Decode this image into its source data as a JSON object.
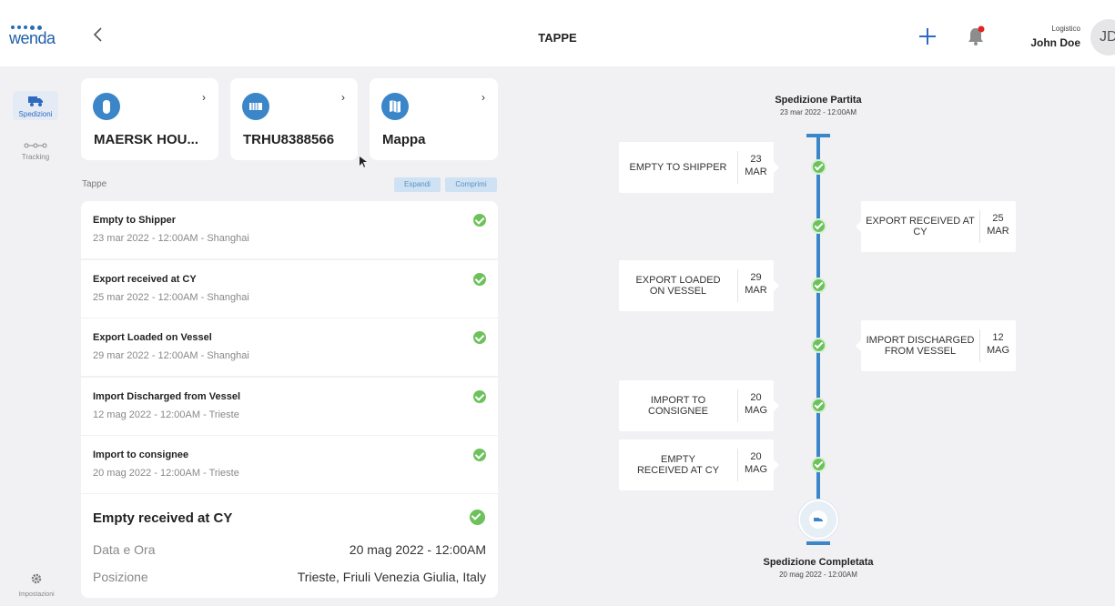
{
  "app": {
    "logo_text": "wenda",
    "page_title": "TAPPE"
  },
  "header": {
    "user_role": "Logistico",
    "user_name": "John Doe",
    "avatar_initials": "JD",
    "notification_dot_color": "#e02424"
  },
  "sidebar": {
    "items": [
      {
        "label": "Spedizioni",
        "icon": "truck-icon",
        "active": true
      },
      {
        "label": "Tracking",
        "icon": "tracking-icon",
        "active": false
      }
    ],
    "settings_label": "Impostazioni"
  },
  "cards": [
    {
      "title": "MAERSK HOU...",
      "icon": "ship-owner-icon"
    },
    {
      "title": "TRHU8388566",
      "icon": "container-icon"
    },
    {
      "title": "Mappa",
      "icon": "map-icon"
    }
  ],
  "stops_section": {
    "label": "Tappe",
    "expand_label": "Espandi",
    "collapse_label": "Comprimi"
  },
  "stops": [
    {
      "name": "Empty to Shipper",
      "date": "23 mar 2022 - 12:00AM - Shanghai"
    },
    {
      "name": "Export received at CY",
      "date": "25 mar 2022 - 12:00AM - Shanghai"
    },
    {
      "name": "Export Loaded on Vessel",
      "date": "29 mar 2022 - 12:00AM - Shanghai"
    },
    {
      "name": "Import Discharged from Vessel",
      "date": "12 mag 2022 - 12:00AM - Trieste"
    },
    {
      "name": "Import to consignee",
      "date": "20 mag 2022 - 12:00AM - Trieste"
    }
  ],
  "detail": {
    "title": "Empty received at CY",
    "date_label": "Data e Ora",
    "date_value": "20 mag 2022 - 12:00AM",
    "position_label": "Posizione",
    "position_value": "Trieste, Friuli Venezia Giulia, Italy"
  },
  "timeline": {
    "start_title": "Spedizione Partita",
    "start_date": "23 mar 2022 - 12:00AM",
    "end_title": "Spedizione Completata",
    "end_date": "20 mag 2022 - 12:00AM",
    "color": "#3a86c8",
    "events": [
      {
        "label": "EMPTY TO SHIPPER",
        "day": "23",
        "month": "MAR",
        "side": "left"
      },
      {
        "label": "EXPORT RECEIVED AT CY",
        "day": "25",
        "month": "MAR",
        "side": "right"
      },
      {
        "label": "EXPORT LOADED ON VESSEL",
        "day": "29",
        "month": "MAR",
        "side": "left"
      },
      {
        "label": "IMPORT DISCHARGED FROM VESSEL",
        "day": "12",
        "month": "MAG",
        "side": "right"
      },
      {
        "label": "IMPORT TO CONSIGNEE",
        "day": "20",
        "month": "MAG",
        "side": "left"
      },
      {
        "label": "EMPTY RECEIVED AT CY",
        "day": "20",
        "month": "MAG",
        "side": "left"
      }
    ]
  },
  "status_color": "#6cc15b"
}
